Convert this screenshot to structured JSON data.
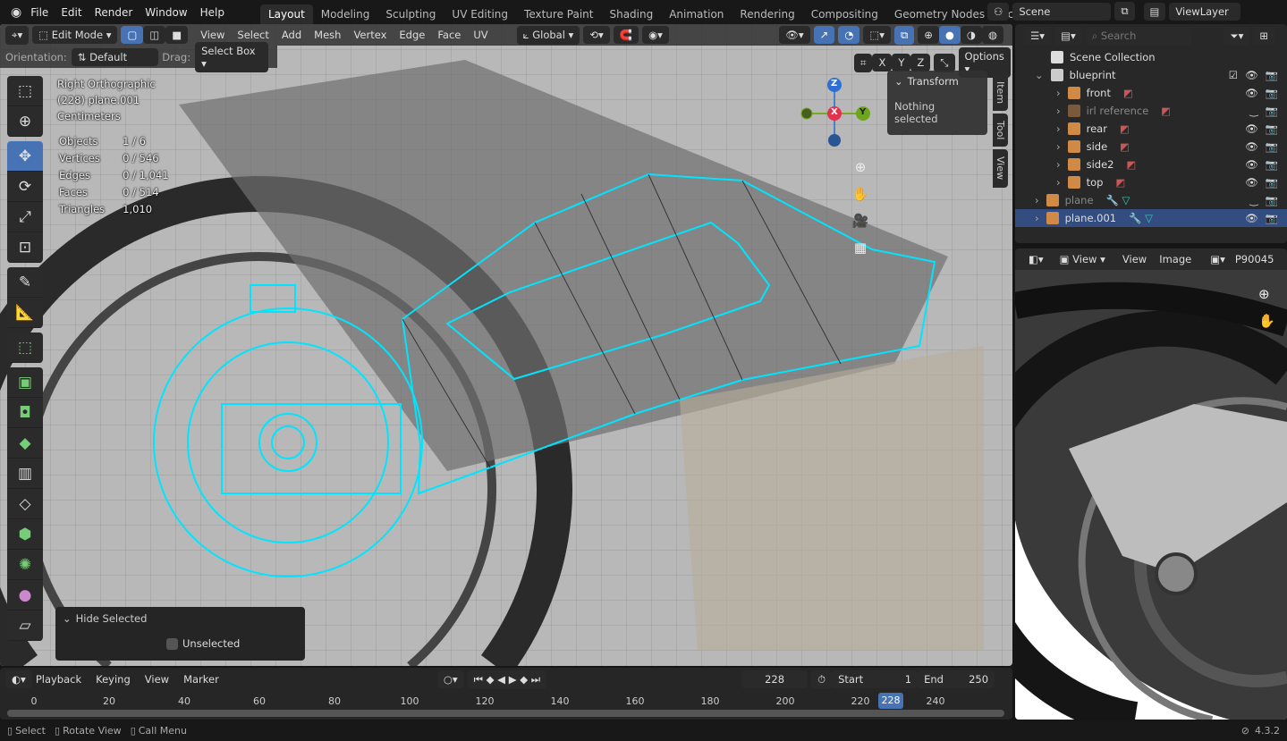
{
  "menu": [
    "File",
    "Edit",
    "Render",
    "Window",
    "Help"
  ],
  "workspaces": [
    "Layout",
    "Modeling",
    "Sculpting",
    "UV Editing",
    "Texture Paint",
    "Shading",
    "Animation",
    "Rendering",
    "Compositing",
    "Geometry Nodes",
    "Scripting"
  ],
  "active_workspace": "Layout",
  "scene": "Scene",
  "view_layer": "ViewLayer",
  "viewport": {
    "mode": "Edit Mode",
    "menus": [
      "View",
      "Select",
      "Add",
      "Mesh",
      "Vertex",
      "Edge",
      "Face",
      "UV"
    ],
    "transform_orientation": "Global",
    "orientation_label": "Orientation:",
    "orientation": "Default",
    "drag_label": "Drag:",
    "drag": "Select Box",
    "axes": [
      "X",
      "Y",
      "Z"
    ],
    "options": "Options",
    "view_name": "Right Orthographic",
    "object_line": "(228) plane.001",
    "units": "Centimeters",
    "stats": [
      [
        "Objects",
        "1 / 6"
      ],
      [
        "Vertices",
        "0 / 546"
      ],
      [
        "Edges",
        "0 / 1,041"
      ],
      [
        "Faces",
        "0 / 514"
      ],
      [
        "Triangles",
        "1,010"
      ]
    ],
    "transform_title": "Transform",
    "transform_msg": "Nothing selected",
    "ntabs": [
      "Item",
      "Tool",
      "View"
    ],
    "gizmo": {
      "z": "Z",
      "x": "X",
      "y": "Y"
    },
    "last_op": "Hide Selected",
    "unselected_label": "Unselected",
    "unselected_checked": false,
    "mesh_color": "#00e5ff"
  },
  "outliner": {
    "search_placeholder": "Search",
    "root": "Scene Collection",
    "collection": "blueprint",
    "items": [
      {
        "name": "front",
        "visible": true
      },
      {
        "name": "irl reference",
        "visible": false
      },
      {
        "name": "rear",
        "visible": true
      },
      {
        "name": "side",
        "visible": true
      },
      {
        "name": "side2",
        "visible": true
      },
      {
        "name": "top",
        "visible": true
      }
    ],
    "objects": [
      {
        "name": "plane",
        "visible": false,
        "selected": false
      },
      {
        "name": "plane.001",
        "visible": true,
        "selected": true
      }
    ]
  },
  "image_editor": {
    "view_menu": "View",
    "menus": [
      "View",
      "Image"
    ],
    "image_name": "P90045"
  },
  "timeline": {
    "menus": [
      "Playback",
      "Keying",
      "View",
      "Marker"
    ],
    "current": "228",
    "start_label": "Start",
    "start": "1",
    "end_label": "End",
    "end": "250",
    "ticks": [
      "0",
      "20",
      "40",
      "60",
      "80",
      "100",
      "120",
      "140",
      "160",
      "180",
      "200",
      "220",
      "240"
    ]
  },
  "status": {
    "items": [
      "Select",
      "Rotate View",
      "Call Menu"
    ],
    "version": "4.3.2"
  }
}
